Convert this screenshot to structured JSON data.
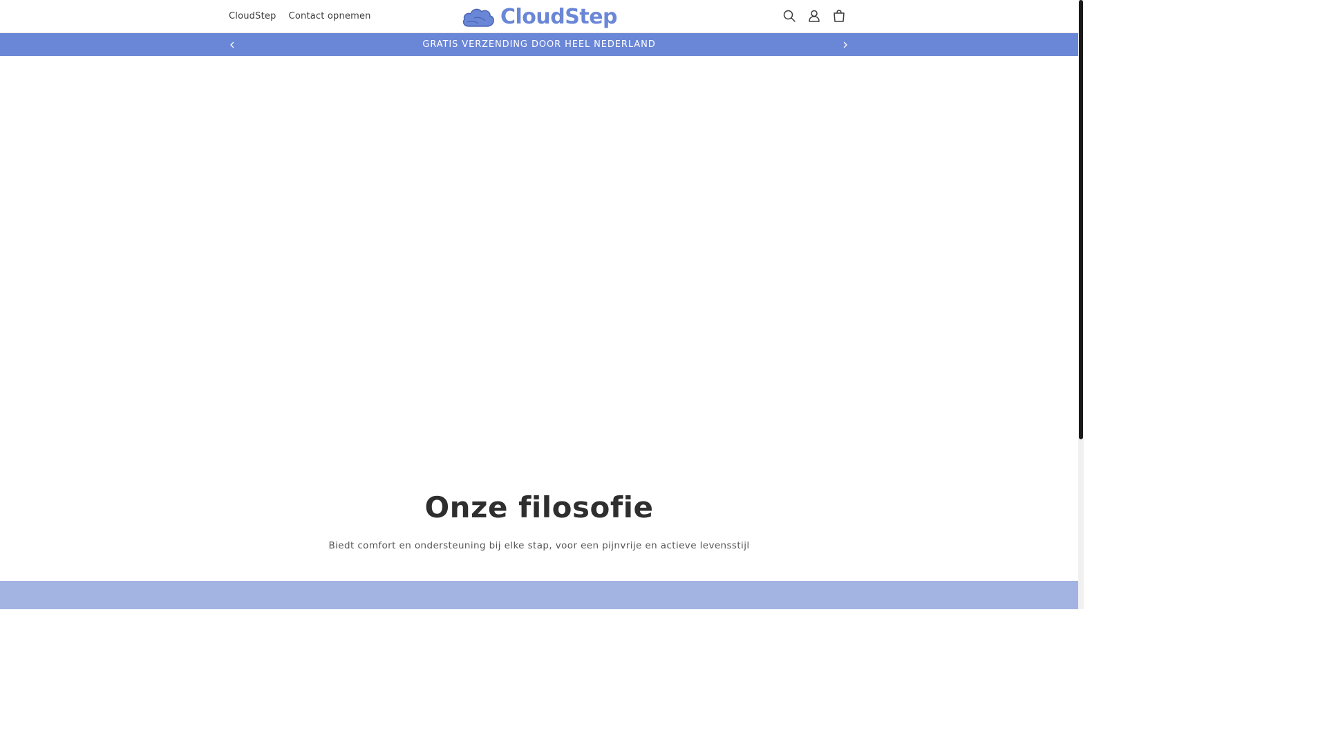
{
  "header": {
    "nav": [
      {
        "label": "CloudStep"
      },
      {
        "label": "Contact opnemen"
      }
    ],
    "logo_text": "CloudStep",
    "icons": [
      "search-icon",
      "account-icon",
      "cart-icon"
    ]
  },
  "announcement": {
    "text": "GRATIS VERZENDING DOOR HEEL NEDERLAND"
  },
  "philosophy": {
    "title": "Onze filosofie",
    "text": "Biedt comfort en ondersteuning bij elke stap, voor een pijnvrije en actieve levensstijl"
  },
  "colors": {
    "brand": "#6a86d6",
    "band": "#a3b4e2"
  }
}
